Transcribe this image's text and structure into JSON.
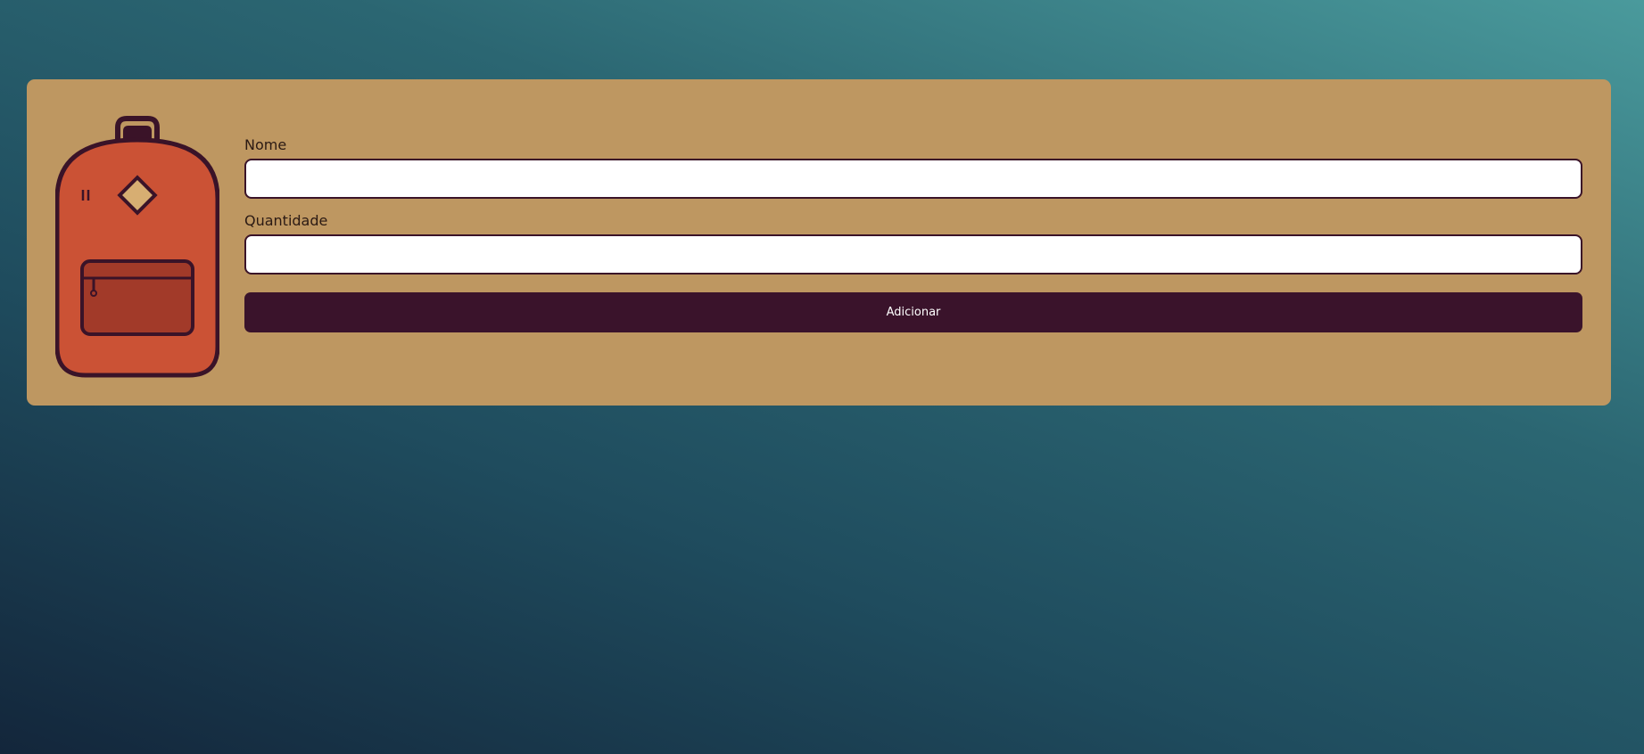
{
  "form": {
    "name_label": "Nome",
    "name_value": "",
    "name_placeholder": "",
    "quantity_label": "Quantidade",
    "quantity_value": "",
    "quantity_placeholder": "",
    "submit_label": "Adicionar"
  },
  "icons": {
    "logo": "backpack-icon"
  },
  "colors": {
    "card_background": "#be9761",
    "button_background": "#3a132b",
    "input_border": "#3a1328",
    "backpack_body": "#cb5235",
    "backpack_pocket": "#a23a29",
    "backpack_outline": "#3a1328"
  }
}
